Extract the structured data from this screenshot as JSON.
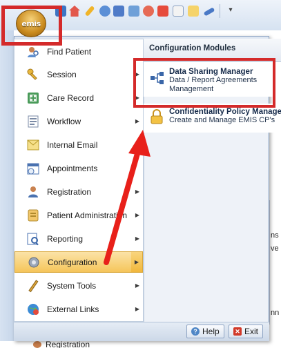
{
  "app": {
    "orb_label": "emis",
    "qat_dropdown": "▾"
  },
  "menu": {
    "items": [
      {
        "label": "Find Patient",
        "icon": "find-patient-icon",
        "has_submenu": false
      },
      {
        "label": "Session",
        "icon": "key-icon",
        "has_submenu": true
      },
      {
        "label": "Care Record",
        "icon": "care-record-icon",
        "has_submenu": true
      },
      {
        "label": "Workflow",
        "icon": "workflow-icon",
        "has_submenu": true
      },
      {
        "label": "Internal Email",
        "icon": "email-icon",
        "has_submenu": false
      },
      {
        "label": "Appointments",
        "icon": "appointments-icon",
        "has_submenu": false
      },
      {
        "label": "Registration",
        "icon": "registration-icon",
        "has_submenu": true
      },
      {
        "label": "Patient Administration",
        "icon": "patient-admin-icon",
        "has_submenu": true
      },
      {
        "label": "Reporting",
        "icon": "reporting-icon",
        "has_submenu": true
      },
      {
        "label": "Configuration",
        "icon": "configuration-icon",
        "has_submenu": true,
        "active": true
      },
      {
        "label": "System Tools",
        "icon": "system-tools-icon",
        "has_submenu": true
      },
      {
        "label": "External Links",
        "icon": "external-links-icon",
        "has_submenu": true
      }
    ]
  },
  "submenu": {
    "header": "Configuration Modules",
    "modules": [
      {
        "title": "Data Sharing Manager",
        "description_line1": "Data / Report Agreements",
        "description_line2": "Management",
        "icon": "data-sharing-icon"
      },
      {
        "title": "Confidentiality Policy Manager",
        "description_line1": "Create and Manage EMIS CP's",
        "description_line2": "",
        "icon": "padlock-icon"
      }
    ]
  },
  "footer": {
    "help_label": "Help",
    "exit_label": "Exit"
  },
  "background": {
    "fragment_1": "ns",
    "fragment_2": "ve",
    "fragment_3": "nn",
    "registration_label": "Registration"
  },
  "colors": {
    "highlight_red": "#d42a2a",
    "active_item": "#f5c55a",
    "menu_background": "#dfe7f2"
  }
}
